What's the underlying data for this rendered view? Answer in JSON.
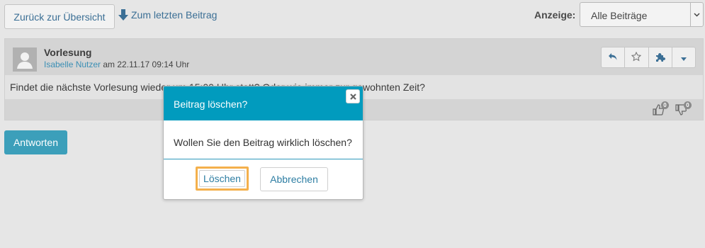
{
  "toolbar": {
    "back_label": "Zurück zur Übersicht",
    "last_post_label": "Zum letzten Beitrag",
    "display_label": "Anzeige:",
    "display_value": "Alle Beiträge"
  },
  "post": {
    "title": "Vorlesung",
    "author": "Isabelle Nutzer",
    "meta_suffix": " am 22.11.17 09:14 Uhr",
    "body": "Findet die nächste Vorlesung wieder um 15:00 Uhr statt? Oder wie immer zur gewohnten Zeit?",
    "likes": "0",
    "dislikes": "0",
    "actions": [
      "reply-icon",
      "star-icon",
      "puzzle-icon",
      "caret-down-icon"
    ]
  },
  "reply_label": "Antworten",
  "dialog": {
    "title": "Beitrag löschen?",
    "message": "Wollen Sie den Beitrag wirklich löschen?",
    "confirm_label": "Löschen",
    "cancel_label": "Abbrechen"
  },
  "colors": {
    "accent": "#019bbe",
    "primary_button": "#3c9fba",
    "link": "#3b6f95",
    "focus_ring": "#f4b04c"
  }
}
